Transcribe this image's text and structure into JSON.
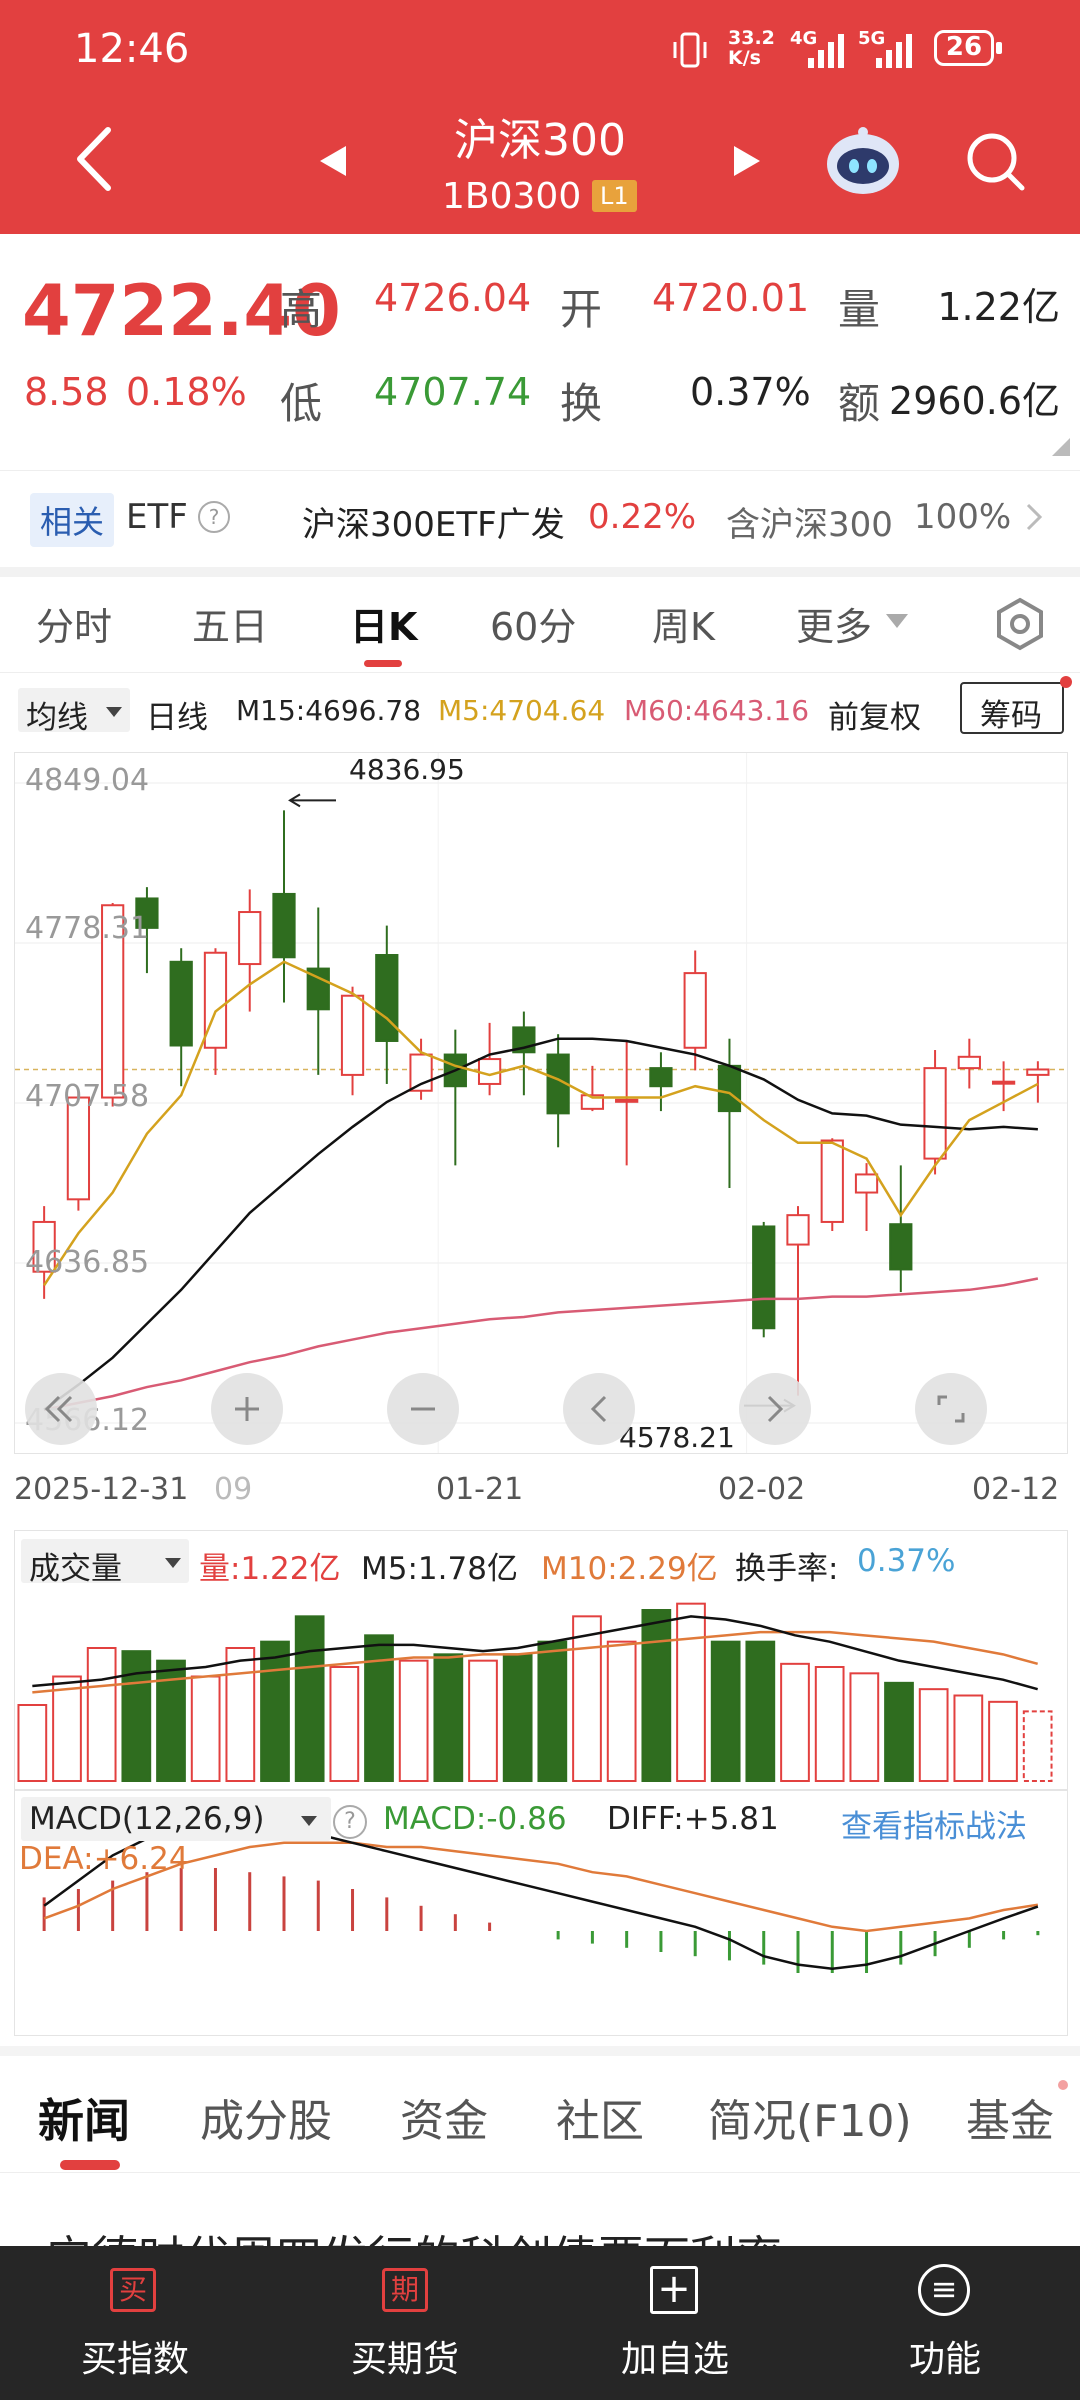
{
  "status_bar": {
    "time": "12:46",
    "net_speed": "33.2\nK/s",
    "sig1": "4G",
    "sig2": "5G",
    "battery": "26"
  },
  "header": {
    "title": "沪深300",
    "code": "1B0300",
    "level_badge": "L1"
  },
  "quote": {
    "price": "4722.40",
    "change": "8.58",
    "change_pct": "0.18%",
    "high_label": "高",
    "high": "4726.04",
    "open_label": "开",
    "open": "4720.01",
    "volume_label": "量",
    "volume": "1.22亿",
    "low_label": "低",
    "low": "4707.74",
    "turnover_label": "换",
    "turnover": "0.37%",
    "amount_label": "额",
    "amount": "2960.6亿"
  },
  "etf_bar": {
    "tag": "相关",
    "etf": "ETF",
    "help": "?",
    "fund_name": "沪深300ETF广发",
    "fund_change": "0.22%",
    "holding_label": "含沪深300",
    "holding_pct": "100%"
  },
  "period_tabs": [
    "分时",
    "五日",
    "日K",
    "60分",
    "周K",
    "更多"
  ],
  "active_tab_index": 2,
  "ma_bar": {
    "ma_selector": "均线",
    "period": "日线",
    "m15": "M15:4696.78",
    "m5": "M5:4704.64",
    "m60": "M60:4643.16",
    "adjust": "前复权",
    "chips_button": "筹码"
  },
  "chart_data": {
    "type": "candlestick",
    "y_labels": [
      "4849.04",
      "4778.31",
      "4707.58",
      "4636.85",
      "4566.12"
    ],
    "ylim": [
      4566.12,
      4849.04
    ],
    "x_labels": [
      "2025-12-31",
      "09",
      "01-21",
      "02-02",
      "02-12"
    ],
    "max_annotation": "4836.95",
    "min_annotation": "4578.21",
    "candles": [
      {
        "o": 4633,
        "c": 4655,
        "h": 4662,
        "l": 4621
      },
      {
        "o": 4665,
        "c": 4710,
        "h": 4713,
        "l": 4660
      },
      {
        "o": 4710,
        "c": 4795,
        "h": 4796,
        "l": 4706
      },
      {
        "o": 4798,
        "c": 4785,
        "h": 4803,
        "l": 4765
      },
      {
        "o": 4770,
        "c": 4733,
        "h": 4776,
        "l": 4715
      },
      {
        "o": 4732,
        "c": 4774,
        "h": 4776,
        "l": 4720
      },
      {
        "o": 4769,
        "c": 4792,
        "h": 4802,
        "l": 4748
      },
      {
        "o": 4800,
        "c": 4772,
        "h": 4836.95,
        "l": 4752
      },
      {
        "o": 4767,
        "c": 4749,
        "h": 4794,
        "l": 4720
      },
      {
        "o": 4720,
        "c": 4755,
        "h": 4759,
        "l": 4711
      },
      {
        "o": 4773,
        "c": 4735,
        "h": 4786,
        "l": 4716
      },
      {
        "o": 4713,
        "c": 4729,
        "h": 4736,
        "l": 4709
      },
      {
        "o": 4729,
        "c": 4715,
        "h": 4740,
        "l": 4680
      },
      {
        "o": 4716,
        "c": 4727,
        "h": 4743,
        "l": 4711
      },
      {
        "o": 4741,
        "c": 4730,
        "h": 4748,
        "l": 4711
      },
      {
        "o": 4729,
        "c": 4703,
        "h": 4738,
        "l": 4688
      },
      {
        "o": 4705,
        "c": 4711,
        "h": 4724,
        "l": 4704
      },
      {
        "o": 4709,
        "c": 4709,
        "h": 4735,
        "l": 4680
      },
      {
        "o": 4723,
        "c": 4715,
        "h": 4730,
        "l": 4704
      },
      {
        "o": 4732,
        "c": 4765,
        "h": 4775,
        "l": 4722
      },
      {
        "o": 4724,
        "c": 4704,
        "h": 4736,
        "l": 4670
      },
      {
        "o": 4653,
        "c": 4608,
        "h": 4655,
        "l": 4604
      },
      {
        "o": 4645,
        "c": 4658,
        "h": 4662,
        "l": 4578.21
      },
      {
        "o": 4655,
        "c": 4691,
        "h": 4692,
        "l": 4651
      },
      {
        "o": 4668,
        "c": 4676,
        "h": 4681,
        "l": 4651
      },
      {
        "o": 4654,
        "c": 4634,
        "h": 4680,
        "l": 4624
      },
      {
        "o": 4683,
        "c": 4723,
        "h": 4731,
        "l": 4676
      },
      {
        "o": 4723,
        "c": 4728,
        "h": 4736,
        "l": 4714
      },
      {
        "o": 4717,
        "c": 4717,
        "h": 4726,
        "l": 4704
      },
      {
        "o": 4720.01,
        "c": 4722.4,
        "h": 4726.04,
        "l": 4707.74
      }
    ],
    "m5": [
      4627,
      4650,
      4668,
      4694,
      4711,
      4748,
      4760,
      4770,
      4763,
      4756,
      4745,
      4730,
      4724,
      4720,
      4724,
      4718,
      4710,
      4710,
      4710,
      4715,
      4712,
      4700,
      4690,
      4690,
      4683,
      4658,
      4680,
      4700,
      4708,
      4716
    ],
    "m15": [
      4572,
      4583,
      4595,
      4610,
      4625,
      4642,
      4659,
      4672,
      4685,
      4697,
      4708,
      4716,
      4722,
      4729,
      4732,
      4736,
      4736,
      4735,
      4732,
      4729,
      4724,
      4718,
      4709,
      4703,
      4702,
      4698,
      4697,
      4696,
      4697,
      4696
    ],
    "m60": [
      4572,
      4575,
      4578,
      4582,
      4585,
      4589,
      4593,
      4596,
      4600,
      4603,
      4606,
      4608,
      4610,
      4612,
      4613,
      4615,
      4616,
      4617,
      4618,
      4619,
      4620,
      4621,
      4621,
      4622,
      4622,
      4623,
      4624,
      4625,
      4627,
      4630
    ]
  },
  "volume_panel": {
    "selector": "成交量",
    "vol": "量:1.22亿",
    "m5": "M5:1.78亿",
    "m10": "M10:2.29亿",
    "turnover_label": "换手率:",
    "turnover": "0.37%",
    "bars": [
      1.2,
      1.65,
      2.1,
      2.05,
      1.9,
      1.65,
      2.1,
      2.2,
      2.6,
      1.8,
      2.3,
      1.9,
      2.0,
      1.9,
      2.0,
      2.2,
      2.6,
      2.2,
      2.7,
      2.8,
      2.2,
      2.2,
      1.85,
      1.8,
      1.7,
      1.55,
      1.45,
      1.35,
      1.25,
      1.1
    ],
    "m5_line": [
      1.5,
      1.55,
      1.6,
      1.7,
      1.75,
      1.8,
      1.9,
      1.95,
      2.05,
      2.1,
      2.15,
      2.15,
      2.1,
      2.05,
      2.1,
      2.2,
      2.3,
      2.4,
      2.5,
      2.6,
      2.55,
      2.45,
      2.3,
      2.2,
      2.05,
      1.9,
      1.8,
      1.7,
      1.6,
      1.45
    ],
    "m10_line": [
      1.4,
      1.45,
      1.5,
      1.55,
      1.6,
      1.65,
      1.7,
      1.75,
      1.8,
      1.85,
      1.9,
      1.95,
      1.95,
      2.0,
      2.0,
      2.05,
      2.1,
      2.15,
      2.2,
      2.25,
      2.3,
      2.35,
      2.35,
      2.35,
      2.3,
      2.25,
      2.2,
      2.1,
      2.0,
      1.85
    ]
  },
  "macd_panel": {
    "selector": "MACD(12,26,9)",
    "help": "?",
    "macd": "MACD:-0.86",
    "diff": "DIFF:+5.81",
    "dea": "DEA:+6.24",
    "strategy_link": "查看指标战法",
    "hist": [
      8,
      10,
      12,
      14,
      15,
      15,
      14,
      13,
      12,
      10,
      8,
      6,
      4,
      2,
      0,
      -2,
      -3,
      -4,
      -5,
      -6,
      -7,
      -8,
      -10,
      -10,
      -10,
      -8,
      -6,
      -4,
      -2,
      -1
    ],
    "diff_line": [
      6,
      12,
      18,
      22,
      24,
      25,
      25,
      24,
      23,
      21,
      19,
      17,
      15,
      13,
      11,
      9,
      7,
      5,
      3,
      1,
      -2,
      -6,
      -8,
      -9,
      -8,
      -6,
      -3,
      0,
      3,
      5.81
    ],
    "dea_line": [
      3,
      6,
      10,
      13,
      16,
      18,
      20,
      21,
      21,
      21,
      20,
      20,
      19,
      18,
      17,
      16,
      14,
      13,
      11,
      9,
      7,
      5,
      3,
      1,
      0,
      1,
      2,
      3,
      5,
      6.24
    ]
  },
  "news_tabs": [
    "新闻",
    "成分股",
    "资金",
    "社区",
    "简况(F10)",
    "基金"
  ],
  "news_headline": "宁德时代周四发行的科创债票面利率",
  "bottom_nav": [
    {
      "icon_char": "买",
      "label": "买指数"
    },
    {
      "icon_char": "期",
      "label": "买期货"
    },
    {
      "icon_char": "+",
      "label": "加自选"
    },
    {
      "icon_char": "≡",
      "label": "功能"
    }
  ],
  "colors": {
    "header_red": "#e24040",
    "up_red": "#e2403f",
    "down_green": "#2f6d1f",
    "m5_yellow": "#d4a21e",
    "m60_pink": "#d85b74",
    "link_blue": "#4a8fd6"
  }
}
